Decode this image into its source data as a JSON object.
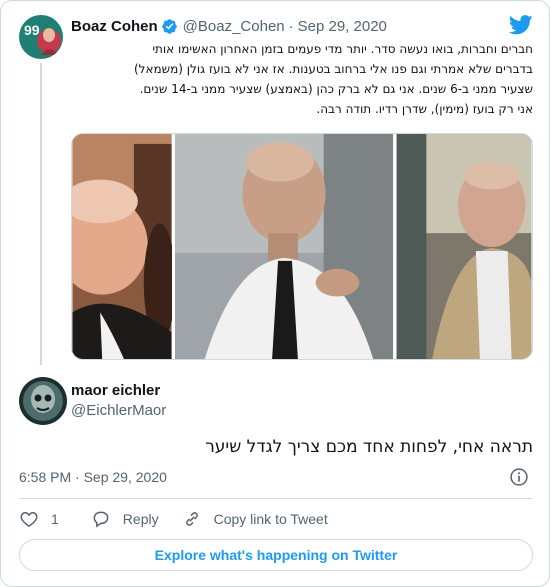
{
  "tweet": {
    "author_name": "Boaz Cohen",
    "author_handle": "@Boaz_Cohen",
    "separator": "·",
    "date": "Sep 29, 2020",
    "text_lines": [
      "חברים וחברות, בואו נעשה סדר. יותר מדי פעמים בזמן האחרון האשימו אותי",
      "בדברים שלא אמרתי וגם פנו אלי ברחוב בטענות. אז אני לא בועז גולן (משמאל)",
      "שצעיר ממני ב-6 שנים. אני גם לא ברק כהן (באמצע) שצעיר ממני ב-14 שנים.",
      "אני רק בועז (מימין), שדרן רדיו.   תודה רבה."
    ],
    "avatar_badge": "99",
    "icons": {
      "verified": "verified-badge-icon",
      "brand": "twitter-bird-icon"
    }
  },
  "reply": {
    "author_name": "maor eichler",
    "author_handle": "@EichlerMaor",
    "text": "תראה אחי, לפחות אחד מכם צריך לגדל שיער",
    "time": "6:58 PM",
    "separator": "·",
    "date": "Sep 29, 2020"
  },
  "actions": {
    "like_count": "1",
    "reply_label": "Reply",
    "copy_link_label": "Copy link to Tweet",
    "icons": [
      "heart-icon",
      "reply-bubble-icon",
      "link-icon",
      "info-icon"
    ]
  },
  "footer": {
    "explore_label": "Explore what's happening on Twitter"
  },
  "colors": {
    "accent": "#1d9bf0",
    "text": "#0f1419",
    "muted": "#536471",
    "border": "#cfd9de"
  }
}
